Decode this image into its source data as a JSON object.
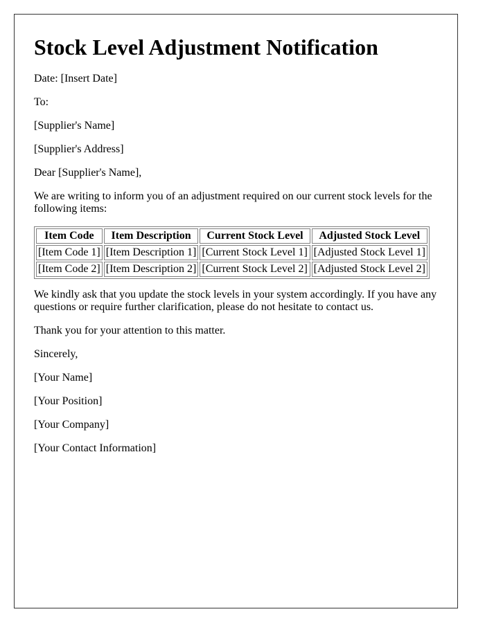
{
  "title": "Stock Level Adjustment Notification",
  "date_line": "Date: [Insert Date]",
  "to_label": "To:",
  "supplier_name": "[Supplier's Name]",
  "supplier_address": "[Supplier's Address]",
  "salutation": "Dear [Supplier's Name],",
  "intro": "We are writing to inform you of an adjustment required on our current stock levels for the following items:",
  "table": {
    "headers": [
      "Item Code",
      "Item Description",
      "Current Stock Level",
      "Adjusted Stock Level"
    ],
    "rows": [
      [
        "[Item Code 1]",
        "[Item Description 1]",
        "[Current Stock Level 1]",
        "[Adjusted Stock Level 1]"
      ],
      [
        "[Item Code 2]",
        "[Item Description 2]",
        "[Current Stock Level 2]",
        "[Adjusted Stock Level 2]"
      ]
    ]
  },
  "request": "We kindly ask that you update the stock levels in your system accordingly. If you have any questions or require further clarification, please do not hesitate to contact us.",
  "thanks": "Thank you for your attention to this matter.",
  "closing": "Sincerely,",
  "signature": {
    "name": "[Your Name]",
    "position": "[Your Position]",
    "company": "[Your Company]",
    "contact": "[Your Contact Information]"
  }
}
